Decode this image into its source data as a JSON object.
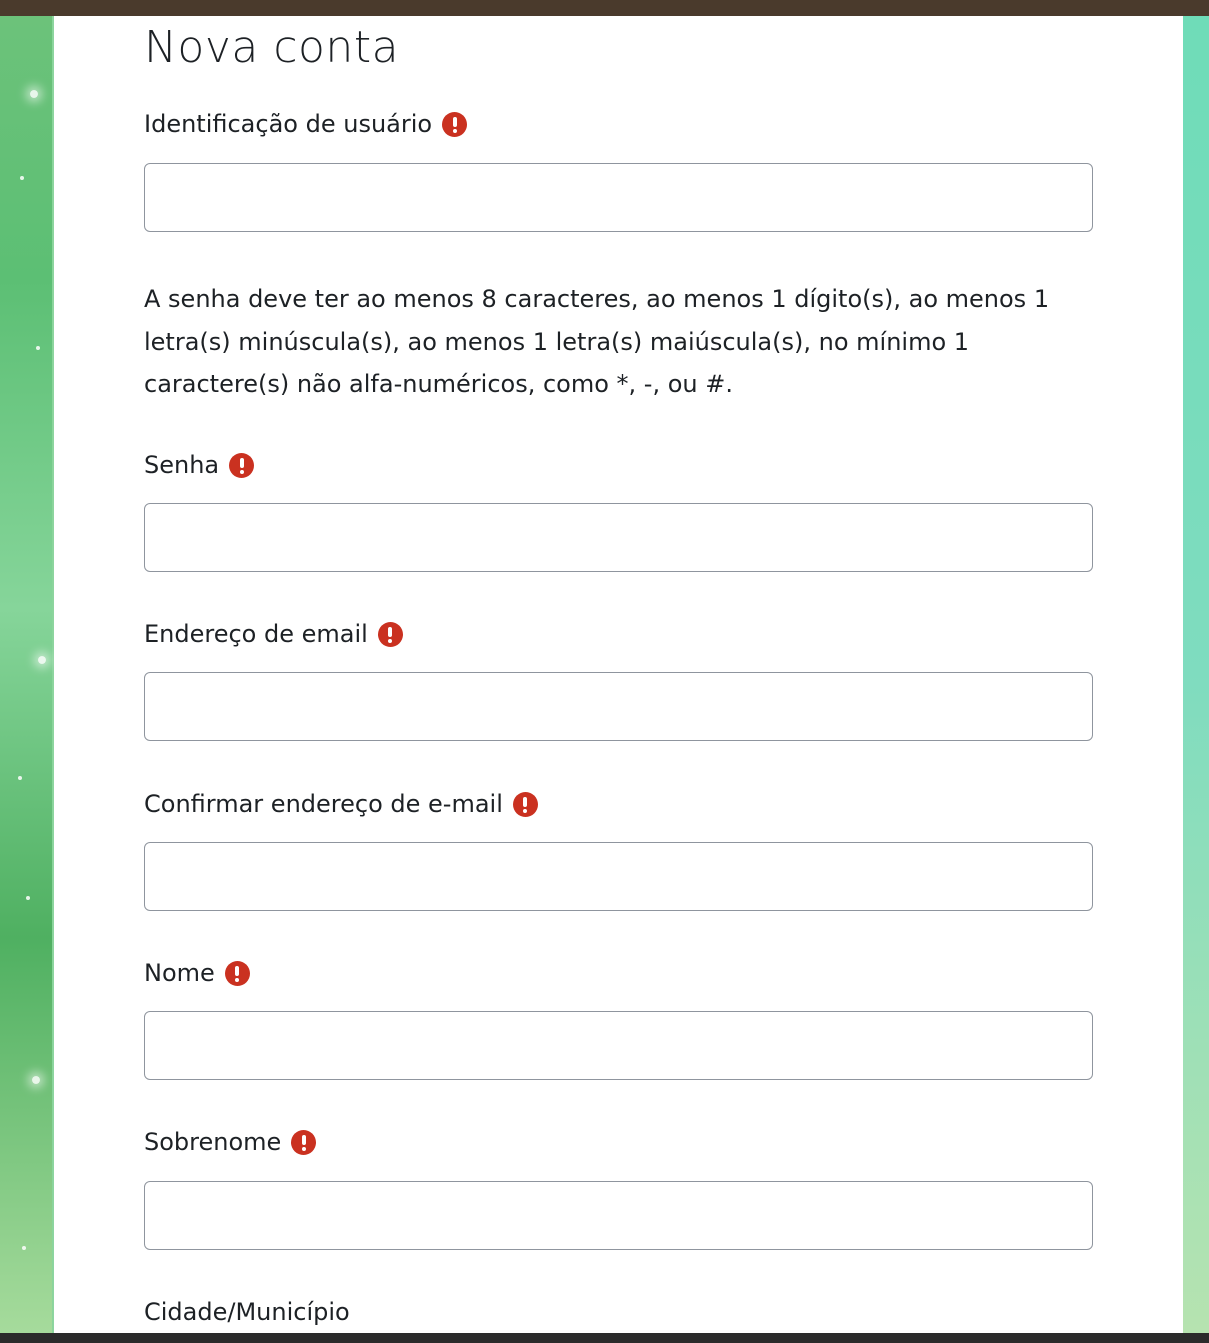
{
  "form": {
    "title": "Nova conta",
    "password_policy": "A senha deve ter ao menos 8 caracteres, ao menos 1 dígito(s), ao menos 1 letra(s) minúscula(s), ao menos 1 letra(s) maiúscula(s), no mínimo 1 caractere(s) não alfa-numéricos, como *, -, ou #.",
    "fields": [
      {
        "label": "Identificação de usuário",
        "value": "",
        "required": true
      },
      {
        "label": "Senha",
        "value": "",
        "required": true
      },
      {
        "label": "Endereço de email",
        "value": "",
        "required": true
      },
      {
        "label": "Confirmar endereço de e-mail",
        "value": "",
        "required": true
      },
      {
        "label": "Nome",
        "value": "",
        "required": true
      },
      {
        "label": "Sobrenome",
        "value": "",
        "required": true
      },
      {
        "label": "Cidade/Município",
        "value": "",
        "required": false
      }
    ]
  },
  "colors": {
    "required_icon": "#ca3120",
    "top_bar": "#4a3a2c",
    "input_border": "#8f959e"
  },
  "icons": {
    "required": "exclamation-circle-icon"
  }
}
